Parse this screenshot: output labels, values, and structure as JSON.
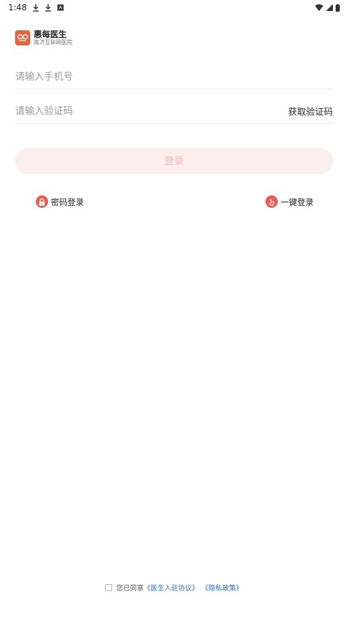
{
  "status_bar": {
    "time": "1:48",
    "icons": [
      "download-icon",
      "download-icon",
      "notification-icon",
      "wifi-icon",
      "signal-icon",
      "battery-icon"
    ]
  },
  "brand": {
    "name": "惠每医生",
    "subtitle": "嵩济互联网医院",
    "logo_color": "#e6643b"
  },
  "form": {
    "phone_placeholder": "请输入手机号",
    "phone_value": "",
    "code_placeholder": "请输入验证码",
    "code_value": "",
    "get_code_label": "获取验证码"
  },
  "login_button": {
    "label": "登录",
    "background": "#fdeeee",
    "text_color": "#f3b9b4"
  },
  "alternate_logins": {
    "password_label": "密码登录",
    "password_icon": "lock-icon",
    "quick_label": "一键登录",
    "quick_icon": "tap-icon",
    "icon_color": "#ef5a4f"
  },
  "agreement": {
    "prefix": "您已同意",
    "doctor_agreement": "《医生入驻协议》",
    "privacy_policy": "《隐私政策》",
    "checked": false,
    "link_color": "#2a6fd6"
  }
}
